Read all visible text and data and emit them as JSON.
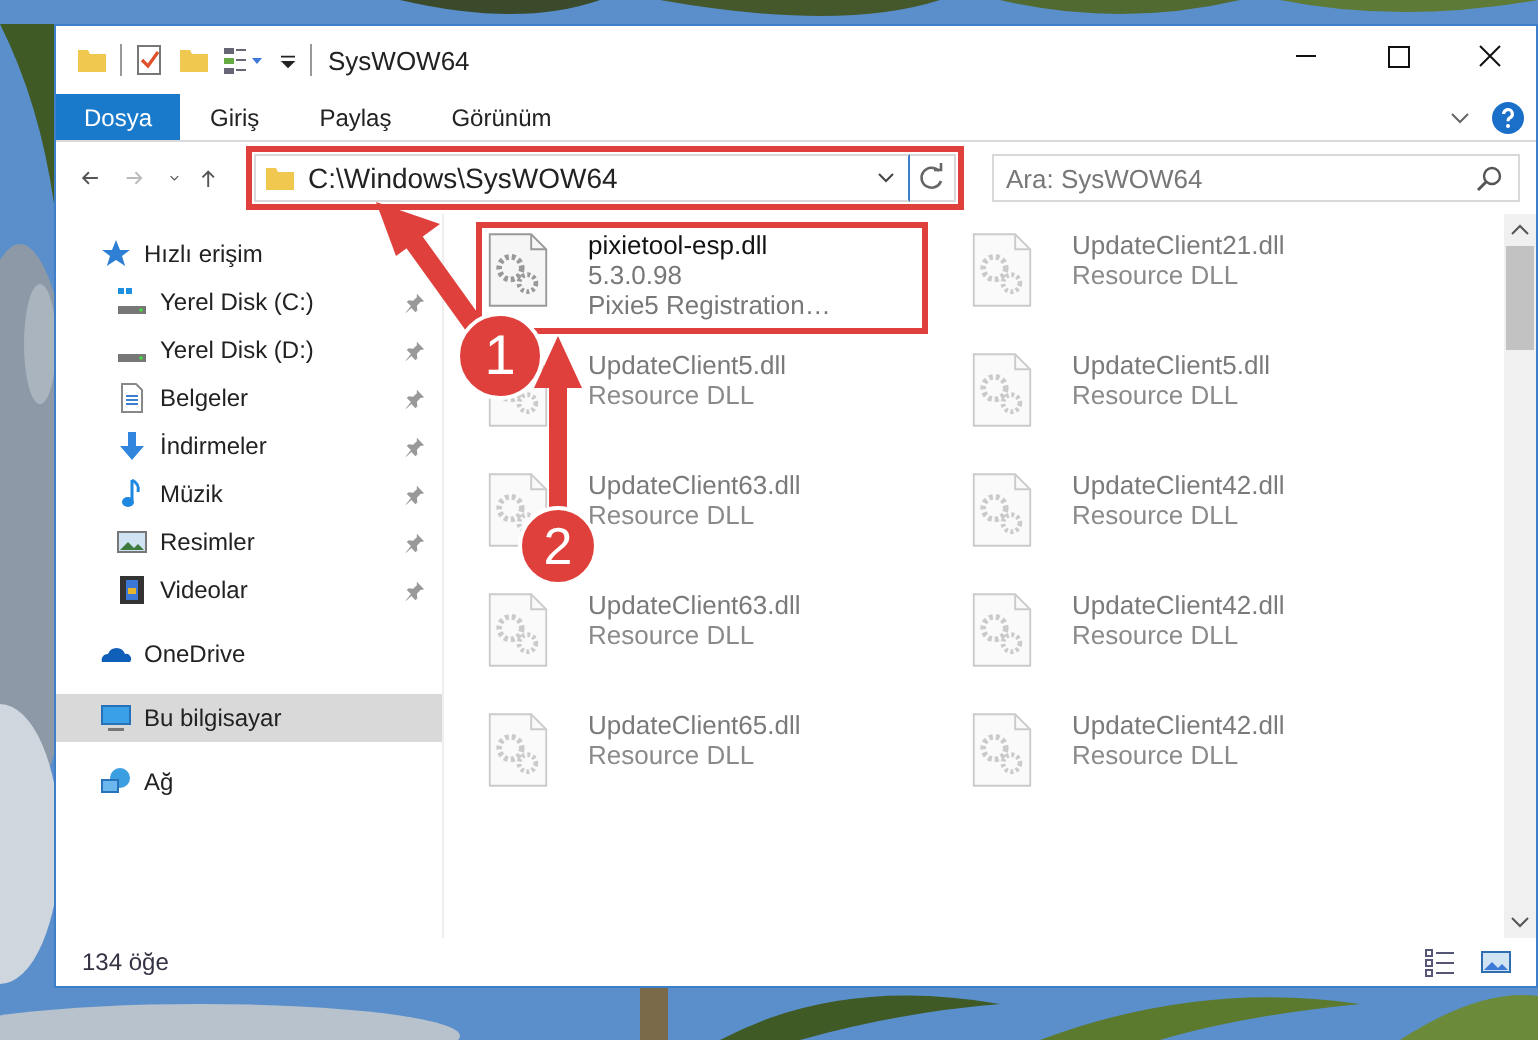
{
  "window": {
    "title": "SysWOW64"
  },
  "ribbon_tabs": [
    {
      "label": "Dosya",
      "selected": true
    },
    {
      "label": "Giriş",
      "selected": false
    },
    {
      "label": "Paylaş",
      "selected": false
    },
    {
      "label": "Görünüm",
      "selected": false
    }
  ],
  "address_bar": {
    "path": "C:\\Windows\\SysWOW64",
    "highlighted": true
  },
  "search": {
    "placeholder": "Ara: SysWOW64"
  },
  "nav": [
    {
      "label": "Hızlı erişim",
      "selected": false,
      "children": [
        {
          "label": "Yerel Disk (C:)",
          "pinned": true
        },
        {
          "label": "Yerel Disk (D:)",
          "pinned": true
        },
        {
          "label": "Belgeler",
          "pinned": true
        },
        {
          "label": "İndirmeler",
          "pinned": true
        },
        {
          "label": "Müzik",
          "pinned": true
        },
        {
          "label": "Resimler",
          "pinned": true
        },
        {
          "label": "Videolar",
          "pinned": true
        }
      ]
    },
    {
      "label": "OneDrive",
      "selected": false
    },
    {
      "label": "Bu bilgisayar",
      "selected": true
    },
    {
      "label": "Ağ",
      "selected": false
    }
  ],
  "files": [
    {
      "name": "pixietool-esp.dll",
      "lines": [
        "5.3.0.98",
        "Pixie5 Registration…"
      ],
      "blurred": false,
      "highlighted": true
    },
    {
      "name": "UpdateClient21.dll",
      "lines": [
        "Resource DLL"
      ],
      "blurred": true,
      "highlighted": false
    },
    {
      "name": "UpdateClient5.dll",
      "lines": [
        "Resource DLL"
      ],
      "blurred": true,
      "highlighted": false
    },
    {
      "name": "UpdateClient5.dll",
      "lines": [
        "Resource DLL"
      ],
      "blurred": true,
      "highlighted": false
    },
    {
      "name": "UpdateClient63.dll",
      "lines": [
        "Resource DLL"
      ],
      "blurred": true,
      "highlighted": false
    },
    {
      "name": "UpdateClient42.dll",
      "lines": [
        "Resource DLL"
      ],
      "blurred": true,
      "highlighted": false
    },
    {
      "name": "UpdateClient63.dll",
      "lines": [
        "Resource DLL"
      ],
      "blurred": true,
      "highlighted": false
    },
    {
      "name": "UpdateClient42.dll",
      "lines": [
        "Resource DLL"
      ],
      "blurred": true,
      "highlighted": false
    },
    {
      "name": "UpdateClient65.dll",
      "lines": [
        "Resource DLL"
      ],
      "blurred": true,
      "highlighted": false
    },
    {
      "name": "UpdateClient42.dll",
      "lines": [
        "Resource DLL"
      ],
      "blurred": true,
      "highlighted": false
    }
  ],
  "status_bar": {
    "count": "134 öğe"
  },
  "callouts": [
    {
      "number": "1"
    },
    {
      "number": "2"
    }
  ]
}
